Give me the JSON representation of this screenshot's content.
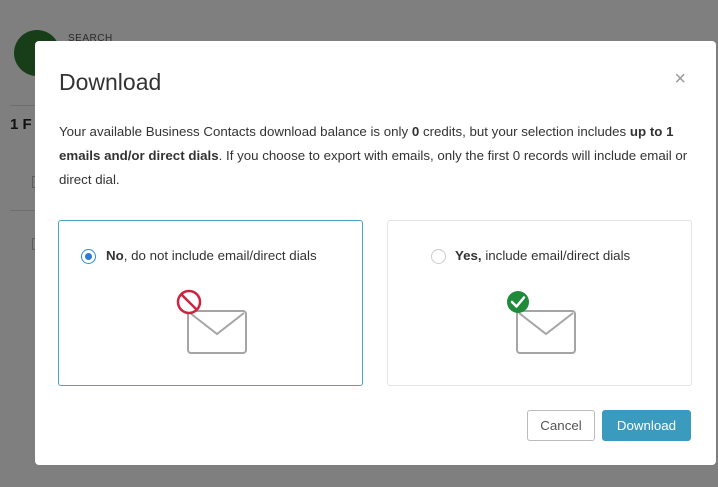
{
  "background": {
    "search_label": "SEARCH",
    "count_prefix": "1 F"
  },
  "modal": {
    "title": "Download",
    "close_symbol": "×",
    "message": {
      "p1": "Your available Business Contacts download balance is only ",
      "credits": "0",
      "p2": " credits, but your selection includes ",
      "selection": "up to 1 emails and/or direct dials",
      "p3": ". If you choose to export with emails, only the first 0 records will include email or direct dial."
    },
    "options": {
      "no": {
        "bold": "No",
        "rest": ", do not include email/direct dials",
        "selected": true,
        "icon": "envelope-blocked-icon"
      },
      "yes": {
        "bold": "Yes,",
        "rest": " include email/direct dials",
        "selected": false,
        "icon": "envelope-approved-icon"
      }
    },
    "buttons": {
      "cancel": "Cancel",
      "download": "Download"
    }
  },
  "colors": {
    "accent": "#3a9bbf",
    "blocked": "#d0223f",
    "approved": "#1e8a3a"
  }
}
